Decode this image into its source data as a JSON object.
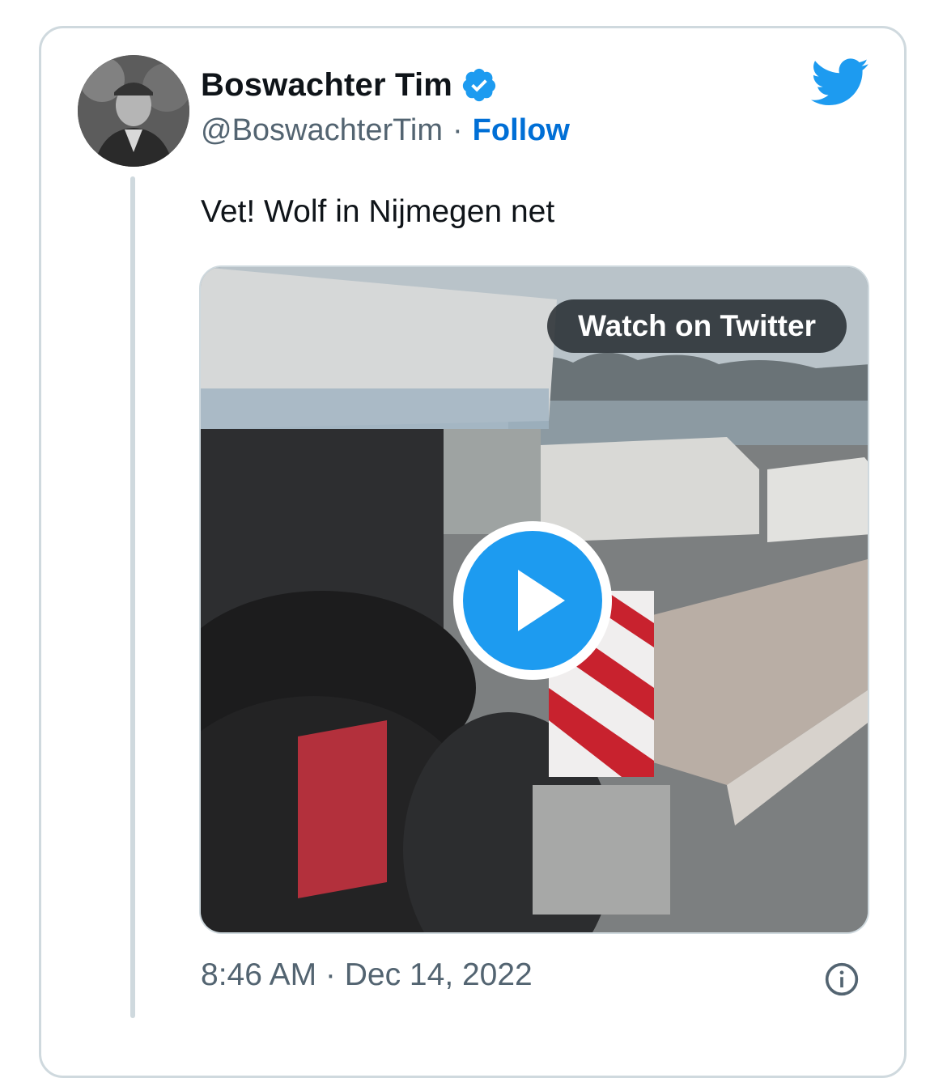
{
  "tweet": {
    "display_name": "Boswachter Tim",
    "handle": "@BoswachterTim",
    "separator": "·",
    "follow_label": "Follow",
    "text": "Vet! Wolf in Nijmegen net",
    "media": {
      "watch_label": "Watch on Twitter"
    },
    "timestamp": "8:46 AM · Dec 14, 2022"
  },
  "colors": {
    "accent": "#1d9bf0",
    "follow": "#006fd6",
    "text_primary": "#0f1419",
    "text_secondary": "#536471",
    "border": "#cfd9de"
  },
  "icons": {
    "verified": "verified-badge-icon",
    "logo": "twitter-bird-icon",
    "play": "play-icon",
    "info": "info-icon"
  }
}
